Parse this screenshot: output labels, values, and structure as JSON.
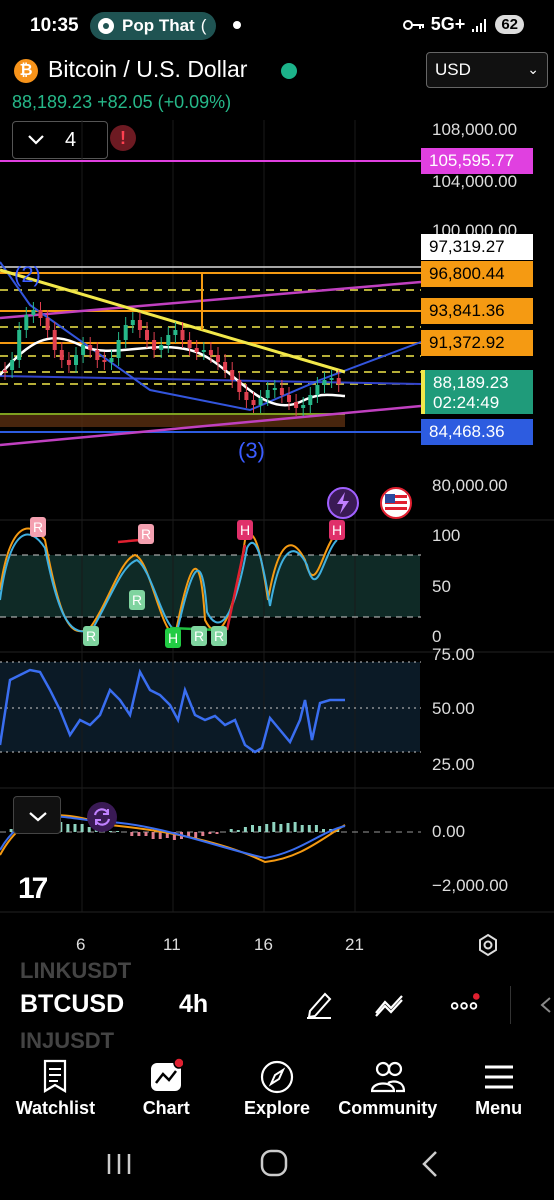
{
  "status_bar": {
    "time": "10:35",
    "notification_app": "Pop That",
    "network": "5G+",
    "battery": "62"
  },
  "header": {
    "pair_title": "Bitcoin / U.S. Dollar",
    "price_line": "88,189.23  +82.05 (+0.09%)",
    "currency": "USD",
    "indicator_count": "4",
    "alert_mark": "!"
  },
  "price_axis": {
    "ticks": [
      "108,000.00",
      "104,000.00",
      "100,000.00",
      "80,000.00"
    ],
    "tags": {
      "level_1": "105,595.77",
      "level_2": "97,319.27",
      "level_3": "96,800.44",
      "level_4": "93,841.36",
      "level_5": "91,372.92",
      "last_price": "88,189.23",
      "countdown": "02:24:49",
      "level_6": "84,468.36"
    }
  },
  "wave_labels": {
    "wave_2": "(2)",
    "wave_3": "(3)"
  },
  "oscillator_1": {
    "ticks": [
      "100",
      "50",
      "0"
    ],
    "markers": [
      "R",
      "R",
      "R",
      "R",
      "H",
      "R",
      "R",
      "H",
      "H"
    ]
  },
  "oscillator_2": {
    "ticks": [
      "75.00",
      "50.00",
      "25.00"
    ]
  },
  "oscillator_3": {
    "ticks": [
      "0.00",
      "−2,000.00"
    ]
  },
  "time_axis": {
    "ticks": [
      "6",
      "11",
      "16",
      "21"
    ]
  },
  "watermark": "17",
  "symbol_bar": {
    "ghost_above": "LINKUSDT",
    "symbol": "BTCUSD",
    "timeframe": "4h",
    "ghost_below": "INJUSDT"
  },
  "bottom_nav": [
    {
      "label": "Watchlist",
      "icon": "watchlist-icon"
    },
    {
      "label": "Chart",
      "icon": "chart-icon"
    },
    {
      "label": "Explore",
      "icon": "compass-icon"
    },
    {
      "label": "Community",
      "icon": "people-icon"
    },
    {
      "label": "Menu",
      "icon": "menu-icon"
    }
  ],
  "colors": {
    "up": "#26b889",
    "last_price_tag": "#1f9b7a",
    "orange_tag": "#f59a12",
    "magenta_tag": "#e040e0",
    "blue_tag": "#2d5ce0",
    "ma_yellow": "#f2e84a",
    "wave_blue": "#3a5cff"
  }
}
